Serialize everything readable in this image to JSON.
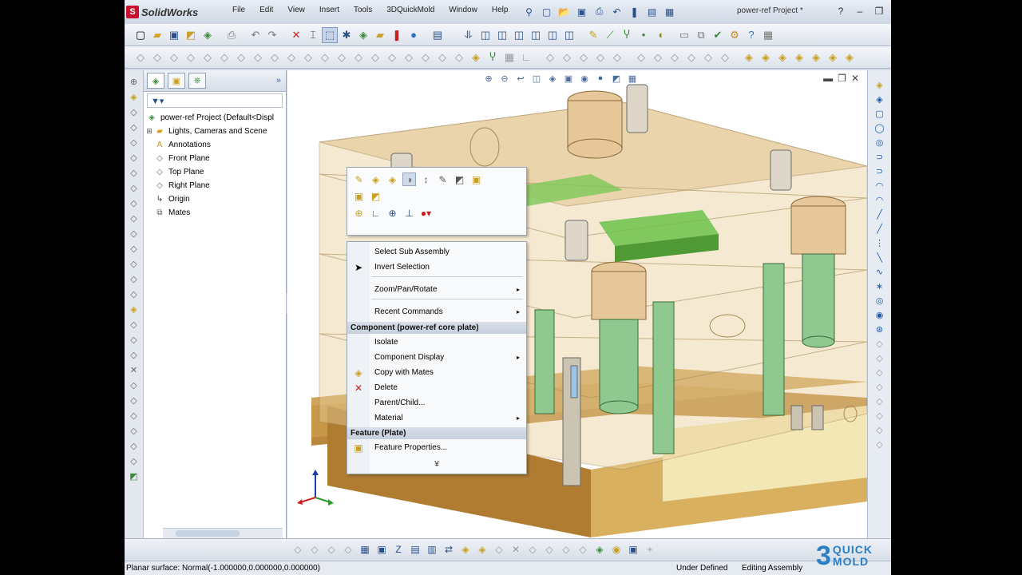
{
  "app": {
    "logo_text": "SolidWorks",
    "logo_mark": "S"
  },
  "menu": [
    "File",
    "Edit",
    "View",
    "Insert",
    "Tools",
    "3DQuickMold",
    "Window",
    "Help"
  ],
  "document_title": "power-ref Project *",
  "tree": {
    "root": "power-ref Project  (Default<Displ",
    "items": [
      {
        "label": "Lights, Cameras and Scene",
        "expandable": true
      },
      {
        "label": "Annotations",
        "expandable": false
      },
      {
        "label": "Front Plane",
        "expandable": false
      },
      {
        "label": "Top Plane",
        "expandable": false
      },
      {
        "label": "Right Plane",
        "expandable": false
      },
      {
        "label": "Origin",
        "expandable": false
      },
      {
        "label": "Mates",
        "expandable": false
      }
    ]
  },
  "context_menu": {
    "items1": [
      "Select Sub Assembly",
      "Invert Selection"
    ],
    "zoom": "Zoom/Pan/Rotate",
    "recent": "Recent Commands",
    "component_header": "Component (power-ref core plate)",
    "component_items": [
      "Isolate",
      "Component Display",
      "Copy with Mates",
      "Delete",
      "Parent/Child...",
      "Material"
    ],
    "feature_header": "Feature (Plate)",
    "feature_props": "Feature Properties...",
    "more": "¥"
  },
  "status": {
    "left": "Planar surface: Normal(-1.000000,0.000000,0.000000)",
    "mid": "Under Defined",
    "right": "Editing Assembly"
  },
  "brand": {
    "line1": "QUICK",
    "line2": "MOLD"
  },
  "colors": {
    "mold_base": "#c89a48",
    "mold_plate_transparent": "#e9cf9d",
    "pillar_green": "#8fc98f",
    "bushing": "#e6c79a",
    "core_green": "#6cc24a",
    "accent_blue": "#2a4f88"
  }
}
